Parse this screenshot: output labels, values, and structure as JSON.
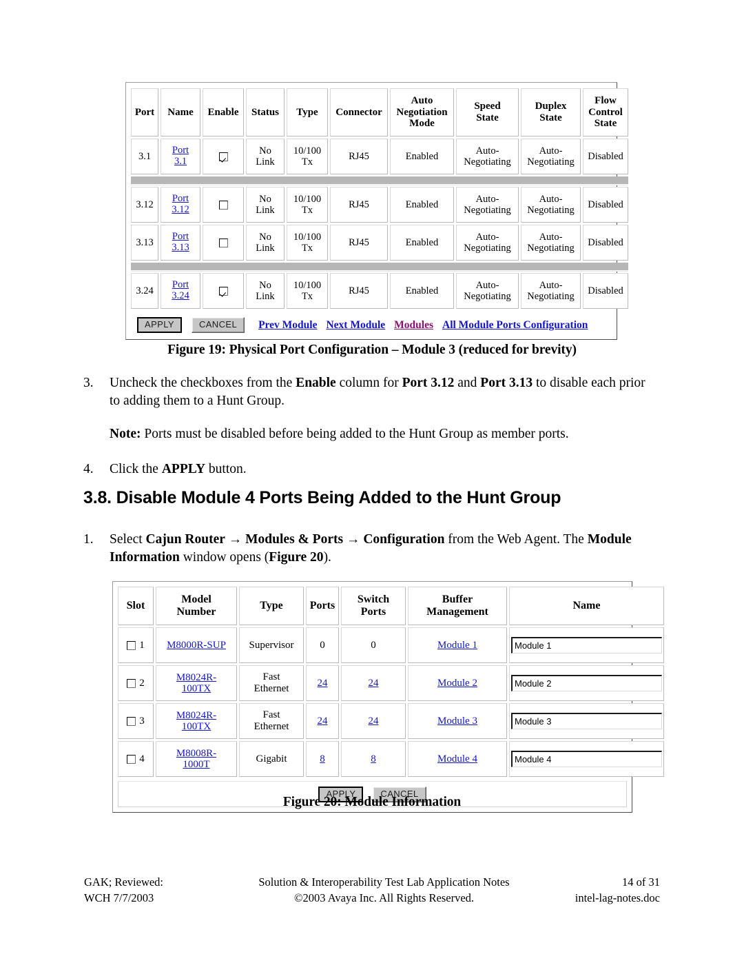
{
  "figure19": {
    "caption": "Figure 19: Physical Port Configuration – Module 3 (reduced for brevity)",
    "columns": [
      "Port",
      "Name",
      "Enable",
      "Status",
      "Type",
      "Connector",
      "Auto Negotiation Mode",
      "Speed State",
      "Duplex State",
      "Flow Control State"
    ],
    "column_lines": [
      [
        "Port"
      ],
      [
        "Name"
      ],
      [
        "Enable"
      ],
      [
        "Status"
      ],
      [
        "Type"
      ],
      [
        "Connector"
      ],
      [
        "Auto",
        "Negotiation",
        "Mode"
      ],
      [
        "Speed",
        "State"
      ],
      [
        "Duplex",
        "State"
      ],
      [
        "Flow",
        "Control",
        "State"
      ]
    ],
    "rows": [
      {
        "port": "3.1",
        "name_link_line1": "Port",
        "name_link_line2": "3.1",
        "enable_checked": true,
        "status_line1": "No",
        "status_line2": "Link",
        "type_line1": "10/100",
        "type_line2": "Tx",
        "connector": "RJ45",
        "auto_negotiation_mode": "Enabled",
        "speed_state_line1": "Auto-",
        "speed_state_line2": "Negotiating",
        "duplex_state_line1": "Auto-",
        "duplex_state_line2": "Negotiating",
        "flow_control_state": "Disabled"
      },
      {
        "port": "3.12",
        "name_link_line1": "Port",
        "name_link_line2": "3.12",
        "enable_checked": false,
        "status_line1": "No",
        "status_line2": "Link",
        "type_line1": "10/100",
        "type_line2": "Tx",
        "connector": "RJ45",
        "auto_negotiation_mode": "Enabled",
        "speed_state_line1": "Auto-",
        "speed_state_line2": "Negotiating",
        "duplex_state_line1": "Auto-",
        "duplex_state_line2": "Negotiating",
        "flow_control_state": "Disabled"
      },
      {
        "port": "3.13",
        "name_link_line1": "Port",
        "name_link_line2": "3.13",
        "enable_checked": false,
        "status_line1": "No",
        "status_line2": "Link",
        "type_line1": "10/100",
        "type_line2": "Tx",
        "connector": "RJ45",
        "auto_negotiation_mode": "Enabled",
        "speed_state_line1": "Auto-",
        "speed_state_line2": "Negotiating",
        "duplex_state_line1": "Auto-",
        "duplex_state_line2": "Negotiating",
        "flow_control_state": "Disabled"
      },
      {
        "port": "3.24",
        "name_link_line1": "Port",
        "name_link_line2": "3.24",
        "enable_checked": true,
        "status_line1": "No",
        "status_line2": "Link",
        "type_line1": "10/100",
        "type_line2": "Tx",
        "connector": "RJ45",
        "auto_negotiation_mode": "Enabled",
        "speed_state_line1": "Auto-",
        "speed_state_line2": "Negotiating",
        "duplex_state_line1": "Auto-",
        "duplex_state_line2": "Negotiating",
        "flow_control_state": "Disabled"
      }
    ],
    "actions": {
      "apply_label": "APPLY",
      "cancel_label": "CANCEL",
      "link_prev_module": "Prev Module",
      "link_next_module": "Next Module",
      "link_modules": "Modules",
      "link_all_module_ports": "All Module Ports Configuration"
    },
    "link_color": "#1414c8",
    "visited_link_color": "#86116e"
  },
  "step3": {
    "number": "3.",
    "p1_a": "Uncheck the checkboxes from the ",
    "p1_b": "Enable",
    "p1_c": " column for ",
    "p1_d": "Port 3.12",
    "p1_e": " and ",
    "p1_f": "Port 3.13",
    "p1_g": " to disable each prior to adding them to a Hunt Group.",
    "note_label": "Note:",
    "note_text": " Ports must be disabled before being added to the Hunt Group as member ports."
  },
  "step4": {
    "number": "4.",
    "a": "Click the ",
    "b": "APPLY",
    "c": " button."
  },
  "section": {
    "heading": "3.8. Disable Module 4 Ports Being Added to the Hunt Group"
  },
  "step1": {
    "number": "1.",
    "a": "Select ",
    "b": "Cajun Router",
    "arrow1": "→",
    "c": "Modules & Ports",
    "arrow2": "→",
    "d": "Configuration",
    "e": " from the Web Agent.  The ",
    "f": "Module Information",
    "g": " window opens (",
    "h": "Figure 20",
    "i": ")."
  },
  "figure20": {
    "caption": "Figure 20: Module Information",
    "columns": [
      "Slot",
      "Model Number",
      "Type",
      "Ports",
      "Switch Ports",
      "Buffer Management",
      "Name"
    ],
    "column_lines": [
      [
        "Slot"
      ],
      [
        "Model",
        "Number"
      ],
      [
        "Type"
      ],
      [
        "Ports"
      ],
      [
        "Switch",
        "Ports"
      ],
      [
        "Buffer",
        "Management"
      ],
      [
        "Name"
      ]
    ],
    "rows": [
      {
        "slot": "1",
        "slot_checked": false,
        "model_line1": "M8000R-SUP",
        "model_line2": "",
        "model_is_link": true,
        "type_line1": "Supervisor",
        "type_line2": "",
        "ports": "0",
        "ports_is_link": false,
        "switch_ports": "0",
        "switch_ports_is_link": false,
        "buffer_management": "Module 1",
        "name_value": "Module 1"
      },
      {
        "slot": "2",
        "slot_checked": false,
        "model_line1": "M8024R-",
        "model_line2": "100TX",
        "model_is_link": true,
        "type_line1": "Fast",
        "type_line2": "Ethernet",
        "ports": "24",
        "ports_is_link": true,
        "switch_ports": "24",
        "switch_ports_is_link": true,
        "buffer_management": "Module 2",
        "name_value": "Module 2"
      },
      {
        "slot": "3",
        "slot_checked": false,
        "model_line1": "M8024R-",
        "model_line2": "100TX",
        "model_is_link": true,
        "type_line1": "Fast",
        "type_line2": "Ethernet",
        "ports": "24",
        "ports_is_link": true,
        "switch_ports": "24",
        "switch_ports_is_link": true,
        "buffer_management": "Module 3",
        "name_value": "Module 3"
      },
      {
        "slot": "4",
        "slot_checked": false,
        "model_line1": "M8008R-",
        "model_line2": "1000T",
        "model_is_link": true,
        "type_line1": "Gigabit",
        "type_line2": "",
        "ports": "8",
        "ports_is_link": true,
        "switch_ports": "8",
        "switch_ports_is_link": true,
        "buffer_management": "Module 4",
        "name_value": "Module 4"
      }
    ],
    "actions": {
      "apply_label": "APPLY",
      "cancel_label": "CANCEL"
    }
  },
  "footer": {
    "left_line1": "GAK; Reviewed:",
    "left_line2": "WCH 7/7/2003",
    "mid_line1": "Solution & Interoperability Test Lab Application Notes",
    "mid_line2": "©2003 Avaya Inc. All Rights Reserved.",
    "right_line1": "14 of 31",
    "right_line2": "intel-lag-notes.doc"
  }
}
